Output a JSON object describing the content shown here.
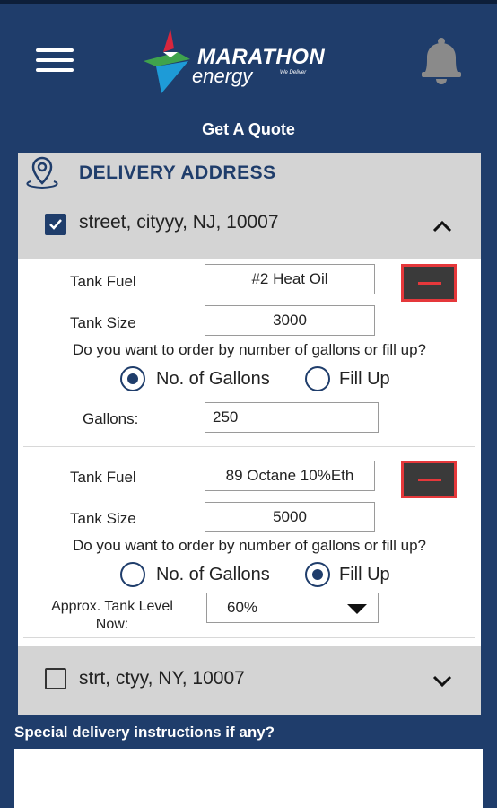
{
  "colors": {
    "navy": "#1f3d6b",
    "accent_red": "#e5383b",
    "header_gray": "#d4d4d4"
  },
  "header": {
    "menu_icon": "hamburger-icon",
    "logo": {
      "brand": "MARATHON",
      "sub": "energy",
      "tagline": "We Deliver"
    },
    "bell_icon": "bell-icon",
    "title": "Get A Quote"
  },
  "delivery": {
    "section_title": "DELIVERY ADDRESS",
    "section_icon": "location-pin-icon",
    "addresses": [
      {
        "label": "street, cityyy, NJ, 10007",
        "checked": true,
        "expanded": true,
        "tanks": [
          {
            "fuel_label": "Tank Fuel",
            "fuel_value": "#2 Heat Oil",
            "size_label": "Tank Size",
            "size_value": "3000",
            "question": "Do you want to order by number of gallons or fill up?",
            "option_gallons": "No. of Gallons",
            "option_fill": "Fill Up",
            "selected": "gallons",
            "gallons_label": "Gallons:",
            "gallons_value": "250"
          },
          {
            "fuel_label": "Tank Fuel",
            "fuel_value": "89 Octane 10%Eth",
            "size_label": "Tank Size",
            "size_value": "5000",
            "question": "Do you want to order by number of gallons or fill up?",
            "option_gallons": "No. of Gallons",
            "option_fill": "Fill Up",
            "selected": "fill",
            "level_label_line1": "Approx. Tank Level",
            "level_label_line2": "Now:",
            "level_value": "60%"
          }
        ]
      },
      {
        "label": "strt, ctyy, NY, 10007",
        "checked": false,
        "expanded": false
      }
    ]
  },
  "special_instructions": {
    "label": "Special delivery instructions if any?",
    "value": ""
  }
}
